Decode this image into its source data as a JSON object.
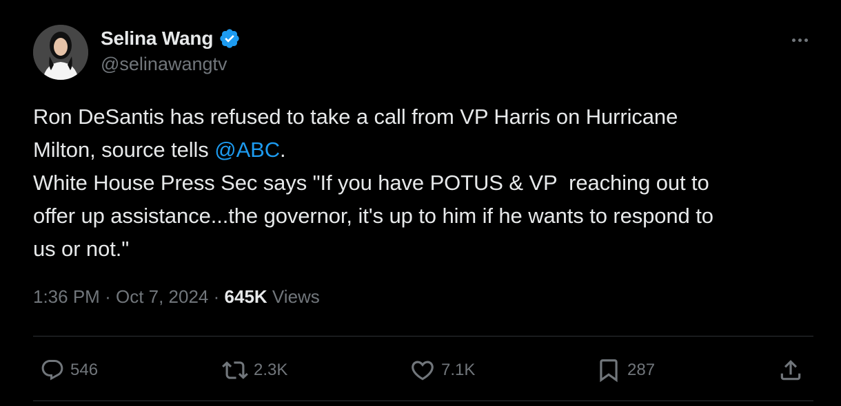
{
  "author": {
    "display_name": "Selina Wang",
    "handle": "@selinawangtv",
    "verified_icon": "verified-badge-icon"
  },
  "tweet": {
    "text_parts": {
      "line1": "Ron DeSantis has refused to take a call from VP Harris on Hurricane",
      "line2_prefix": "Milton, source tells ",
      "mention": "@ABC",
      "line2_suffix": ".",
      "line3": "White House Press Sec says \"If you have POTUS & VP  reaching out to",
      "line4": "offer up assistance...the governor, it's up to him if he wants to respond to",
      "line5": "us or not.\""
    },
    "time": "1:36 PM",
    "separator": "·",
    "date": "Oct 7, 2024",
    "views_count": "645K",
    "views_label": "Views"
  },
  "actions": {
    "replies": "546",
    "reposts": "2.3K",
    "likes": "7.1K",
    "bookmarks": "287"
  },
  "colors": {
    "background": "#000000",
    "text": "#e7e9ea",
    "muted": "#71767b",
    "accent": "#1d9bf0",
    "divider": "#2f3336"
  }
}
